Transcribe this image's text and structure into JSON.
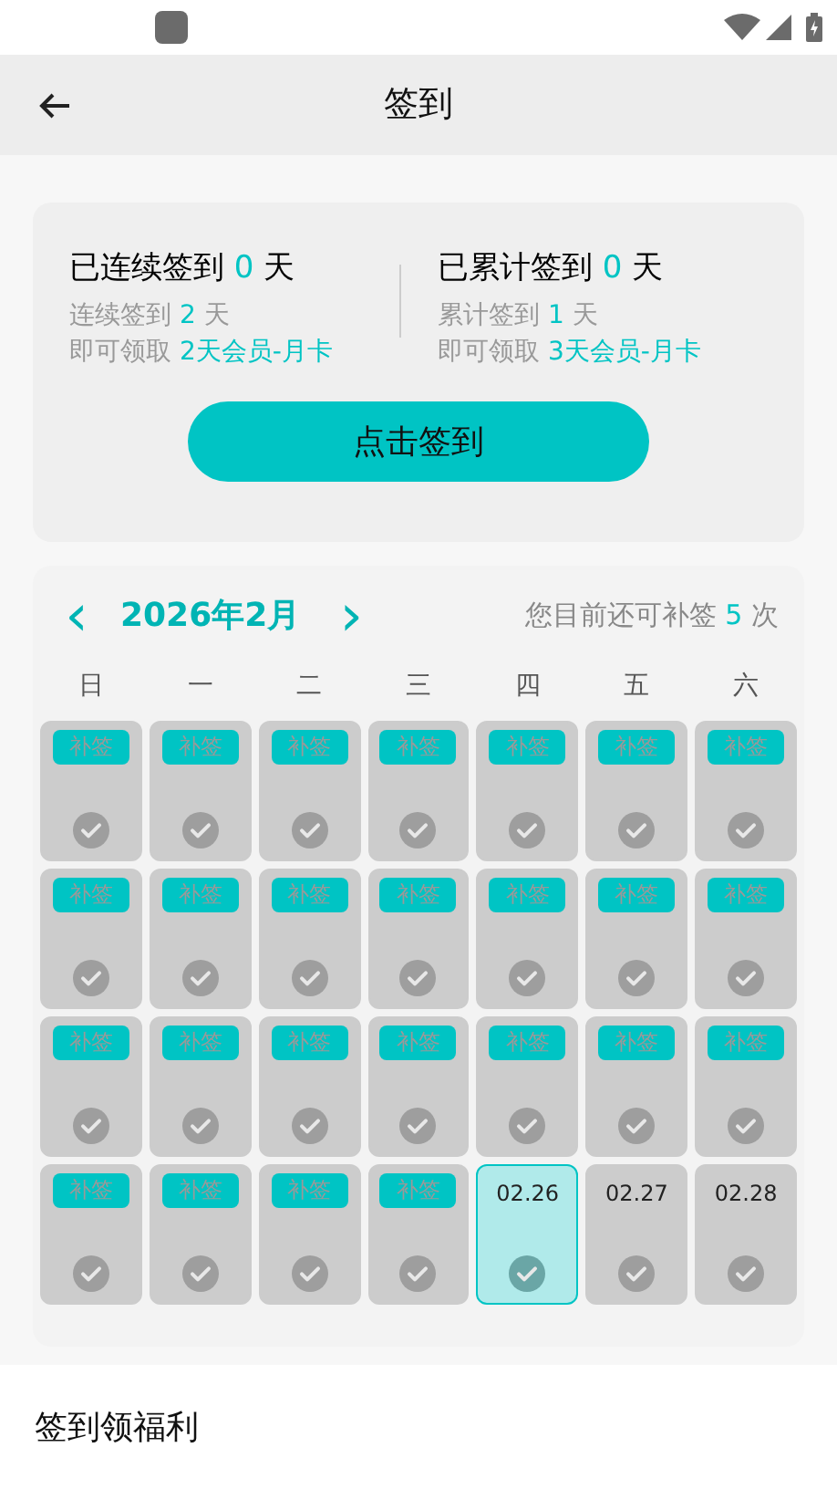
{
  "header": {
    "title": "签到"
  },
  "summary": {
    "left": {
      "title_prefix": "已连续签到",
      "count": "0",
      "title_suffix": "天",
      "line1_prefix": "连续签到",
      "line1_count": "2",
      "line1_suffix": "天",
      "line2_prefix": "即可领取",
      "reward": "2天会员-月卡"
    },
    "right": {
      "title_prefix": "已累计签到",
      "count": "0",
      "title_suffix": "天",
      "line1_prefix": "累计签到",
      "line1_count": "1",
      "line1_suffix": "天",
      "line2_prefix": "即可领取",
      "reward": "3天会员-月卡"
    },
    "button": "点击签到"
  },
  "calendar": {
    "prev": "‹",
    "month": "2026年2月",
    "next": "›",
    "remaining_prefix": "您目前还可补签",
    "remaining_count": "5",
    "remaining_suffix": "次",
    "weekdays": [
      "日",
      "一",
      "二",
      "三",
      "四",
      "五",
      "六"
    ],
    "days": [
      {
        "kind": "makeup",
        "label": "补签",
        "selected": false
      },
      {
        "kind": "makeup",
        "label": "补签",
        "selected": false
      },
      {
        "kind": "makeup",
        "label": "补签",
        "selected": false
      },
      {
        "kind": "makeup",
        "label": "补签",
        "selected": false
      },
      {
        "kind": "makeup",
        "label": "补签",
        "selected": false
      },
      {
        "kind": "makeup",
        "label": "补签",
        "selected": false
      },
      {
        "kind": "makeup",
        "label": "补签",
        "selected": false
      },
      {
        "kind": "makeup",
        "label": "补签",
        "selected": false
      },
      {
        "kind": "makeup",
        "label": "补签",
        "selected": false
      },
      {
        "kind": "makeup",
        "label": "补签",
        "selected": false
      },
      {
        "kind": "makeup",
        "label": "补签",
        "selected": false
      },
      {
        "kind": "makeup",
        "label": "补签",
        "selected": false
      },
      {
        "kind": "makeup",
        "label": "补签",
        "selected": false
      },
      {
        "kind": "makeup",
        "label": "补签",
        "selected": false
      },
      {
        "kind": "makeup",
        "label": "补签",
        "selected": false
      },
      {
        "kind": "makeup",
        "label": "补签",
        "selected": false
      },
      {
        "kind": "makeup",
        "label": "补签",
        "selected": false
      },
      {
        "kind": "makeup",
        "label": "补签",
        "selected": false
      },
      {
        "kind": "makeup",
        "label": "补签",
        "selected": false
      },
      {
        "kind": "makeup",
        "label": "补签",
        "selected": false
      },
      {
        "kind": "makeup",
        "label": "补签",
        "selected": false
      },
      {
        "kind": "makeup",
        "label": "补签",
        "selected": false
      },
      {
        "kind": "makeup",
        "label": "补签",
        "selected": false
      },
      {
        "kind": "makeup",
        "label": "补签",
        "selected": false
      },
      {
        "kind": "makeup",
        "label": "补签",
        "selected": false
      },
      {
        "kind": "date",
        "label": "02.26",
        "selected": true
      },
      {
        "kind": "date",
        "label": "02.27",
        "selected": false
      },
      {
        "kind": "date",
        "label": "02.28",
        "selected": false
      }
    ]
  },
  "section": {
    "title": "签到领福利"
  }
}
